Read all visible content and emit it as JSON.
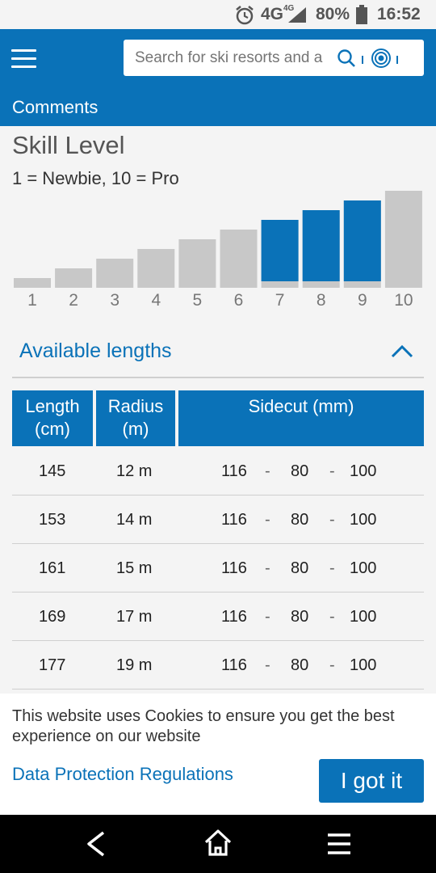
{
  "status_bar": {
    "network": "4G",
    "network_super": "4G",
    "battery": "80%",
    "time": "16:52"
  },
  "header": {
    "search_placeholder": "Search for ski resorts and a",
    "tab_label": "Comments"
  },
  "skill_level": {
    "title": "Skill Level",
    "legend": "1 = Newbie, 10 = Pro",
    "chart_data": {
      "type": "bar",
      "categories": [
        "1",
        "2",
        "3",
        "4",
        "5",
        "6",
        "7",
        "8",
        "9",
        "10"
      ],
      "values": [
        1,
        2,
        3,
        4,
        5,
        6,
        7,
        8,
        9,
        10
      ],
      "highlighted": [
        false,
        false,
        false,
        false,
        false,
        false,
        true,
        true,
        true,
        false
      ],
      "colors": {
        "default": "#c8c8c8",
        "highlight": "#0a72b8"
      }
    }
  },
  "available_lengths": {
    "title": "Available lengths",
    "columns": [
      {
        "line1": "Length",
        "line2": "(cm)"
      },
      {
        "line1": "Radius",
        "line2": "(m)"
      },
      {
        "line1": "Sidecut (mm)",
        "line2": ""
      }
    ],
    "separator": "-",
    "rows": [
      {
        "length": "145",
        "radius": "12 m",
        "tip": "116",
        "waist": "80",
        "tail": "100"
      },
      {
        "length": "153",
        "radius": "14 m",
        "tip": "116",
        "waist": "80",
        "tail": "100"
      },
      {
        "length": "161",
        "radius": "15 m",
        "tip": "116",
        "waist": "80",
        "tail": "100"
      },
      {
        "length": "169",
        "radius": "17 m",
        "tip": "116",
        "waist": "80",
        "tail": "100"
      },
      {
        "length": "177",
        "radius": "19 m",
        "tip": "116",
        "waist": "80",
        "tail": "100"
      }
    ]
  },
  "cookie": {
    "text": "This website uses Cookies to ensure you get the best experience on our website",
    "link": "Data Protection Regulations",
    "button": "I got it"
  },
  "icons": {
    "status": [
      "alarm-icon",
      "signal-icon",
      "battery-icon"
    ],
    "header": [
      "menu-icon",
      "search-icon",
      "location-target-icon"
    ],
    "section": [
      "chevron-up-icon"
    ],
    "nav": [
      "back-icon",
      "home-icon",
      "recent-apps-icon"
    ]
  },
  "colors": {
    "brand": "#0a72b8",
    "bar_grey": "#c8c8c8",
    "page_bg": "#f4f4f4"
  }
}
